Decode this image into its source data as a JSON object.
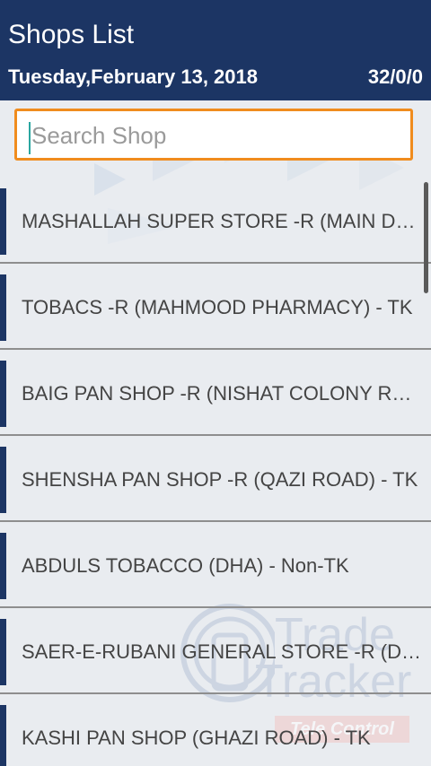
{
  "header": {
    "title": "Shops List",
    "date": "Tuesday,February 13, 2018",
    "counts": "32/0/0"
  },
  "search": {
    "placeholder": "Search Shop",
    "value": ""
  },
  "shops": [
    {
      "name": "MASHALLAH SUPER STORE -R (MAIN DHA) - TK"
    },
    {
      "name": "TOBACS -R (MAHMOOD PHARMACY) - TK"
    },
    {
      "name": "BAIG PAN SHOP -R (NISHAT COLONY RD) - TK"
    },
    {
      "name": "SHENSHA PAN SHOP -R (QAZI ROAD) - TK"
    },
    {
      "name": "ABDULS TOBACCO (DHA) - Non-TK"
    },
    {
      "name": "SAER-E-RUBANI GENERAL STORE -R (DHA) - TK"
    },
    {
      "name": "KASHI PAN SHOP (GHAZI ROAD) - TK"
    }
  ],
  "watermark": {
    "line1": "Trade",
    "line2": "Tracker",
    "badge": "Tele Control"
  },
  "colors": {
    "header_bg": "#1c3564",
    "accent_border": "#f08c1e",
    "row_marker": "#1c3564",
    "divider": "#8e8e8e"
  }
}
